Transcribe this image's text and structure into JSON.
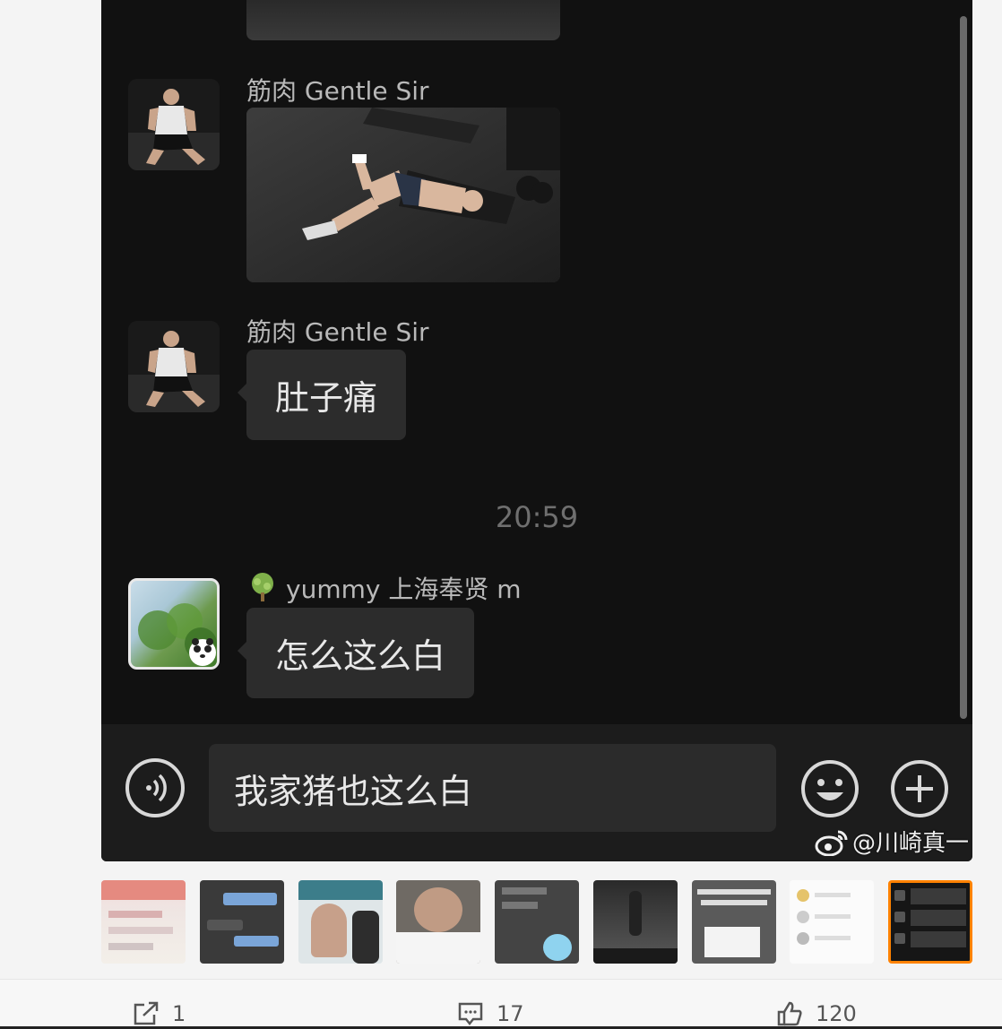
{
  "chat": {
    "messages": [
      {
        "sender": "筋肉 Gentle Sir",
        "type": "image"
      },
      {
        "sender": "筋肉 Gentle Sir",
        "type": "text",
        "text": "肚子痛"
      },
      {
        "sender": "yummy 上海奉贤 m",
        "type": "text",
        "text": "怎么这么白"
      }
    ],
    "timestamp": "20:59",
    "input_value": "我家猪也这么白",
    "watermark": "@川崎真一"
  },
  "thumbnails": {
    "count": 9,
    "selected_index": 8
  },
  "footer": {
    "share_count": "1",
    "comment_count": "17",
    "like_count": "120"
  },
  "colors": {
    "chat_bg": "#111111",
    "bubble_bg": "#2c2c2c",
    "selected_border": "#ff8200"
  },
  "icons": [
    "voice-icon",
    "emoji-icon",
    "plus-icon",
    "share-icon",
    "comment-icon",
    "like-icon",
    "weibo-logo"
  ]
}
